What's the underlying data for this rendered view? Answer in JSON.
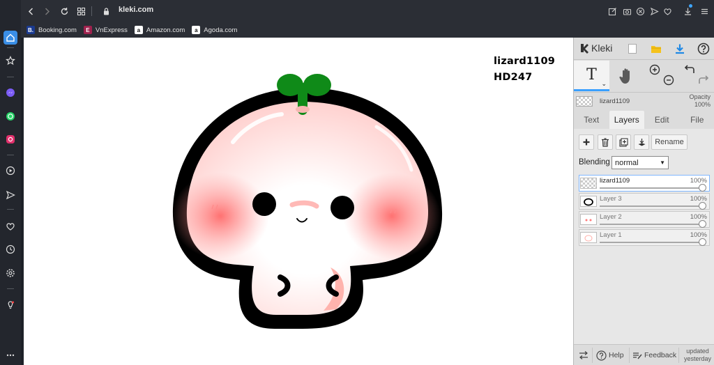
{
  "browser": {
    "url": "kleki.com",
    "bookmarks": [
      {
        "label": "Booking.com",
        "icon": "booking-icon",
        "color": "#1a3a8f"
      },
      {
        "label": "VnExpress",
        "icon": "vnexpress-icon",
        "color": "#9f224e"
      },
      {
        "label": "Amazon.com",
        "icon": "amazon-icon",
        "color": "#ffffff"
      },
      {
        "label": "Agoda.com",
        "icon": "agoda-icon",
        "color": "#ffffff"
      }
    ]
  },
  "sidebar": {
    "items": [
      "home-icon",
      "star-icon",
      "messenger-icon",
      "whatsapp-icon",
      "instagram-icon",
      "player-icon",
      "send-icon",
      "heart-icon",
      "history-icon",
      "settings-icon",
      "bulb-icon",
      "more-icon"
    ]
  },
  "canvas": {
    "text_line1": "lizard1109",
    "text_line2": "HD247"
  },
  "kleki": {
    "logo": "Kleki",
    "current_layer": {
      "name": "lizard1109",
      "opacity_label": "Opacity",
      "opacity_value": "100%"
    },
    "tabs": [
      {
        "label": "Text",
        "active": false
      },
      {
        "label": "Layers",
        "active": true
      },
      {
        "label": "Edit",
        "active": false
      },
      {
        "label": "File",
        "active": false
      }
    ],
    "rename_label": "Rename",
    "blending_label": "Blending",
    "blending_value": "normal",
    "layers": [
      {
        "name": "lizard1109",
        "opacity": "100%",
        "opacity_fraction": 1.0,
        "selected": true
      },
      {
        "name": "Layer 3",
        "opacity": "100%",
        "opacity_fraction": 1.0,
        "selected": false
      },
      {
        "name": "Layer 2",
        "opacity": "100%",
        "opacity_fraction": 1.0,
        "selected": false
      },
      {
        "name": "Layer 1",
        "opacity": "100%",
        "opacity_fraction": 1.0,
        "selected": false
      }
    ],
    "footer": {
      "help": "Help",
      "feedback": "Feedback",
      "updated_line1": "updated",
      "updated_line2": "yesterday"
    },
    "accent": "#3aa0ff"
  }
}
